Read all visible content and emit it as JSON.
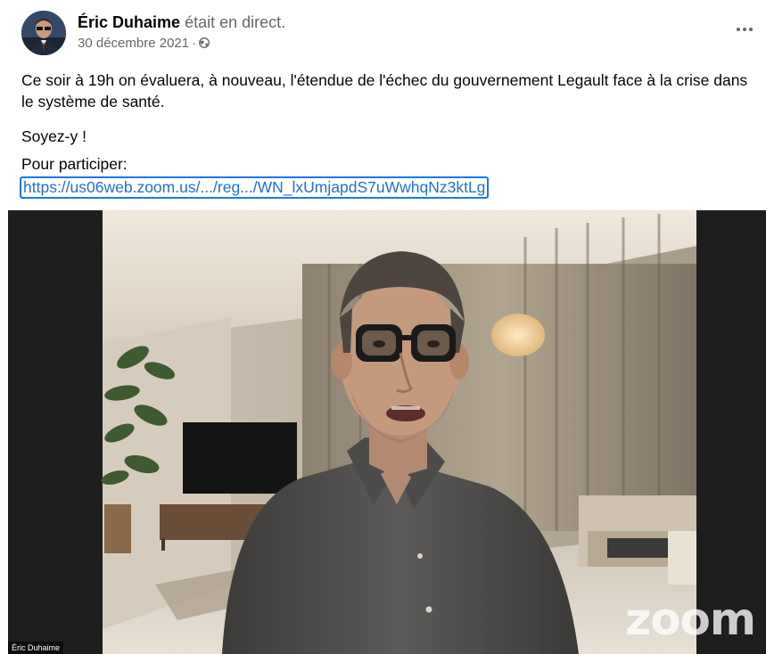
{
  "post": {
    "author_name": "Éric Duhaime",
    "author_status": "était en direct.",
    "date": "30 décembre 2021",
    "separator": "·",
    "privacy_icon": "globe-icon",
    "more_icon": "more-options-icon",
    "paragraphs": [
      "Ce soir à 19h on évaluera, à nouveau, l'étendue de l'échec du gouvernement Legault face à la crise dans le système de santé.",
      "Soyez-y !",
      "Pour participer:"
    ],
    "link_text": "https://us06web.zoom.us/.../reg.../WN_lxUmjapdS7uWwhqNz3ktLg"
  },
  "video": {
    "participant_name": "Éric Duhaime",
    "watermark": "zoom"
  },
  "colors": {
    "link": "#216fdb",
    "link_border": "#1877f2",
    "secondary_text": "#65676b"
  }
}
